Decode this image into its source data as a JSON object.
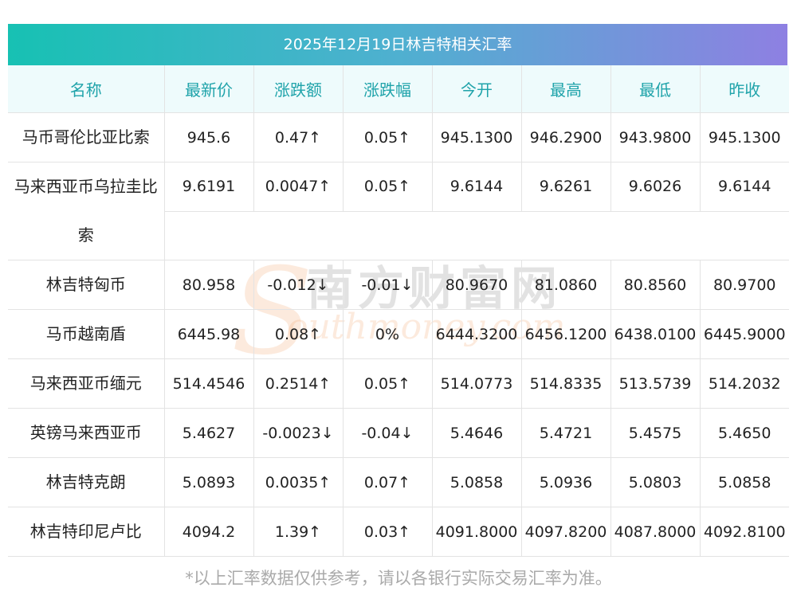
{
  "title": "2025年12月19日林吉特相关汇率",
  "headers": [
    "名称",
    "最新价",
    "涨跌额",
    "涨跌幅",
    "今开",
    "最高",
    "最低",
    "昨收"
  ],
  "rows": [
    {
      "name": "马币哥伦比亚比索",
      "latest": "945.6",
      "change": "0.47↑",
      "pct": "0.05↑",
      "open": "945.1300",
      "high": "946.2900",
      "low": "943.9800",
      "prev": "945.1300",
      "trend": "up"
    },
    {
      "name": "马来西亚币乌拉圭比索",
      "latest": "9.6191",
      "change": "0.0047↑",
      "pct": "0.05↑",
      "open": "9.6144",
      "high": "9.6261",
      "low": "9.6026",
      "prev": "9.6144",
      "trend": "up"
    },
    {
      "name": "林吉特匈币",
      "latest": "80.958",
      "change": "-0.012↓",
      "pct": "-0.01↓",
      "open": "80.9670",
      "high": "81.0860",
      "low": "80.8560",
      "prev": "80.9700",
      "trend": "down"
    },
    {
      "name": "马币越南盾",
      "latest": "6445.98",
      "change": "0.08↑",
      "pct": "0%",
      "open": "6444.3200",
      "high": "6456.1200",
      "low": "6438.0100",
      "prev": "6445.9000",
      "trend": "mixed"
    },
    {
      "name": "马来西亚币缅元",
      "latest": "514.4546",
      "change": "0.2514↑",
      "pct": "0.05↑",
      "open": "514.0773",
      "high": "514.8335",
      "low": "513.5739",
      "prev": "514.2032",
      "trend": "up"
    },
    {
      "name": "英镑马来西亚币",
      "latest": "5.4627",
      "change": "-0.0023↓",
      "pct": "-0.04↓",
      "open": "5.4646",
      "high": "5.4721",
      "low": "5.4575",
      "prev": "5.4650",
      "trend": "down"
    },
    {
      "name": "林吉特克朗",
      "latest": "5.0893",
      "change": "0.0035↑",
      "pct": "0.07↑",
      "open": "5.0858",
      "high": "5.0936",
      "low": "5.0803",
      "prev": "5.0858",
      "trend": "up"
    },
    {
      "name": "林吉特印尼卢比",
      "latest": "4094.2",
      "change": "1.39↑",
      "pct": "0.03↑",
      "open": "4091.8000",
      "high": "4097.8200",
      "low": "4087.8000",
      "prev": "4092.8100",
      "trend": "up"
    }
  ],
  "watermark": {
    "cn": "南方财富网",
    "en": "outhmoney.com",
    "letter": "S"
  },
  "footnote": "*以上汇率数据仅供参考，请以各银行实际交易汇率为准。",
  "colors": {
    "up": "#e8202a",
    "down": "#1b8a1b",
    "header_text": "#1fa3aa",
    "title_gradient_start": "#17c1b3",
    "title_gradient_end": "#8e80e2"
  }
}
